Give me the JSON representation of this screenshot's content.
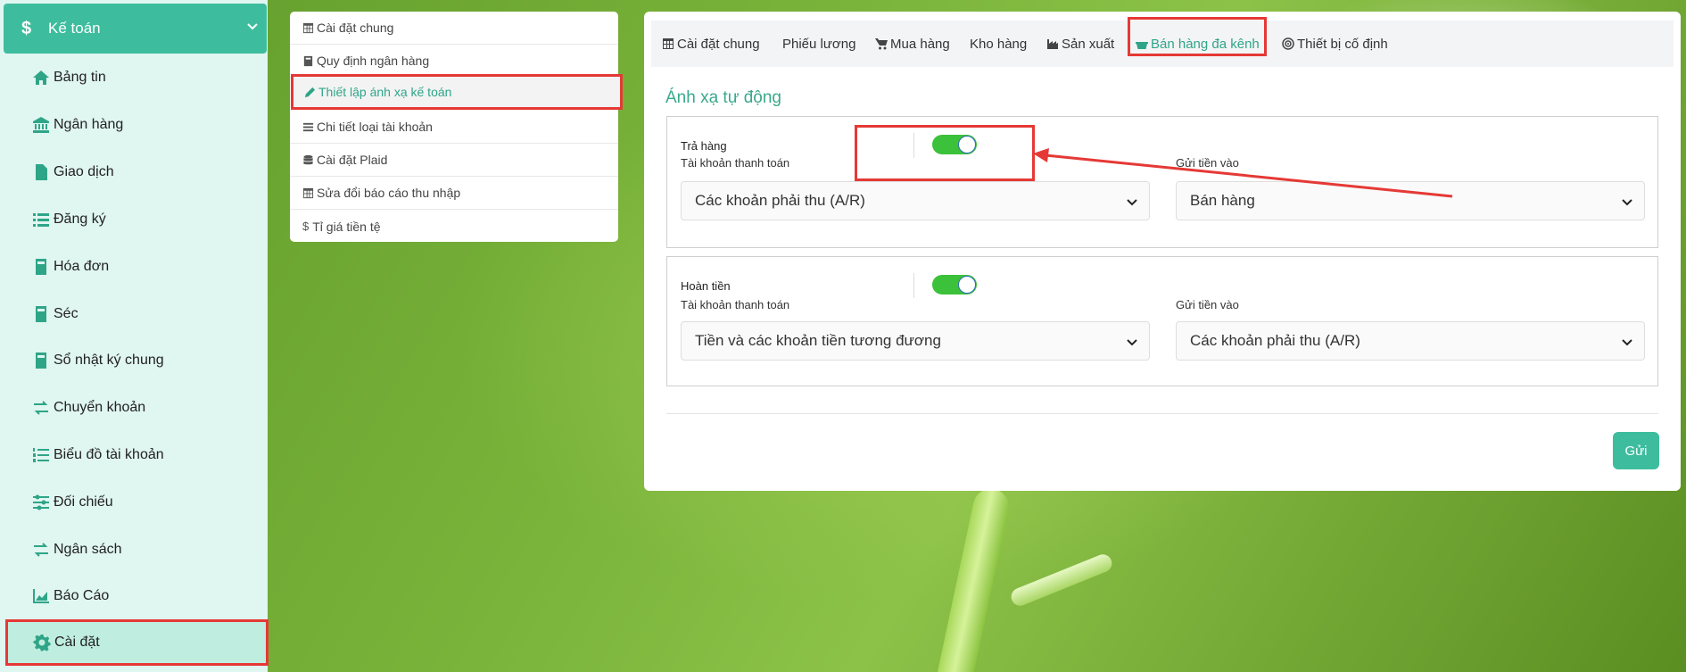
{
  "sidebar": {
    "header": {
      "title": "Kế toán"
    },
    "items": [
      {
        "label": "Bảng tin",
        "icon": "home-icon"
      },
      {
        "label": "Ngân hàng",
        "icon": "bank-icon"
      },
      {
        "label": "Giao dịch",
        "icon": "file-icon"
      },
      {
        "label": "Đăng ký",
        "icon": "list-icon"
      },
      {
        "label": "Hóa đơn",
        "icon": "book-icon"
      },
      {
        "label": "Séc",
        "icon": "book-icon"
      },
      {
        "label": "Sổ nhật ký chung",
        "icon": "book-icon"
      },
      {
        "label": "Chuyển khoản",
        "icon": "exchange-icon"
      },
      {
        "label": "Biểu đồ tài khoản",
        "icon": "ordered-list-icon"
      },
      {
        "label": "Đối chiếu",
        "icon": "sliders-icon"
      },
      {
        "label": "Ngân sách",
        "icon": "exchange-icon"
      },
      {
        "label": "Báo Cáo",
        "icon": "area-chart-icon"
      },
      {
        "label": "Cài đặt",
        "icon": "gear-icon"
      }
    ]
  },
  "settings_menu": {
    "items": [
      {
        "label": "Cài đặt chung",
        "icon": "table-icon"
      },
      {
        "label": "Quy định ngân hàng",
        "icon": "book-icon"
      },
      {
        "label": "Thiết lập ánh xạ kế toán",
        "icon": "pencil-icon"
      },
      {
        "label": "Chi tiết loại tài khoản",
        "icon": "bars-icon"
      },
      {
        "label": "Cài đặt Plaid",
        "icon": "database-icon"
      },
      {
        "label": "Sửa đổi báo cáo thu nhập",
        "icon": "table-icon"
      },
      {
        "label": "Tỉ giá tiền tệ",
        "icon": "dollar-icon"
      }
    ]
  },
  "tabs": [
    {
      "label": "Cài đặt chung",
      "icon": "table-icon"
    },
    {
      "label": "Phiếu lương",
      "icon": ""
    },
    {
      "label": "Mua hàng",
      "icon": "cart-icon"
    },
    {
      "label": "Kho hàng",
      "icon": ""
    },
    {
      "label": "Sản xuất",
      "icon": "industry-icon"
    },
    {
      "label": "Bán hàng đa kênh",
      "icon": "basket-icon"
    },
    {
      "label": "Thiết bị cố định",
      "icon": "target-icon"
    }
  ],
  "main": {
    "section_title": "Ánh xạ tự động",
    "return_card": {
      "label": "Trả hàng",
      "enabled": true,
      "payment_account_label": "Tài khoản thanh toán",
      "payment_account_value": "Các khoản phải thu (A/R)",
      "deposit_label": "Gửi tiền vào",
      "deposit_value": "Bán hàng"
    },
    "refund_card": {
      "label": "Hoàn tiền",
      "enabled": true,
      "payment_account_label": "Tài khoản thanh toán",
      "payment_account_value": "Tiền và các khoản tiền tương đương",
      "deposit_label": "Gửi tiền vào",
      "deposit_value": "Các khoản phải thu (A/R)"
    },
    "submit_label": "Gửi"
  },
  "colors": {
    "accent": "#3dbd9e",
    "toggle_on": "#3cc13b",
    "highlight_box": "#e53935"
  }
}
